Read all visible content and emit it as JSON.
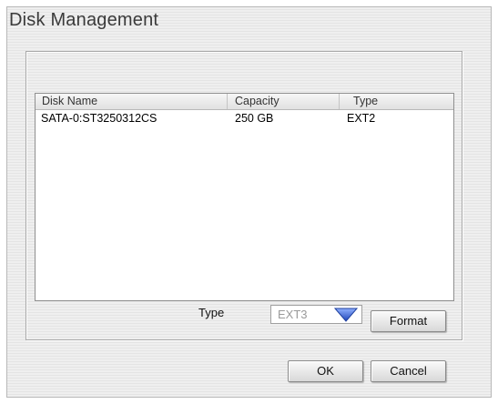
{
  "window": {
    "title": "Disk Management"
  },
  "disk_list": {
    "columns": [
      "Disk Name",
      "Capacity",
      "Type"
    ],
    "rows": [
      {
        "name": "SATA-0:ST3250312CS",
        "capacity": "250 GB",
        "type": "EXT2"
      }
    ]
  },
  "format_panel": {
    "type_label": "Type",
    "selected_type": "EXT3",
    "format_label": "Format"
  },
  "footer": {
    "ok_label": "OK",
    "cancel_label": "Cancel"
  },
  "icons": {
    "dropdown": "triangle-down-icon"
  },
  "colors": {
    "dropdown_arrow": "#2b58c8"
  }
}
